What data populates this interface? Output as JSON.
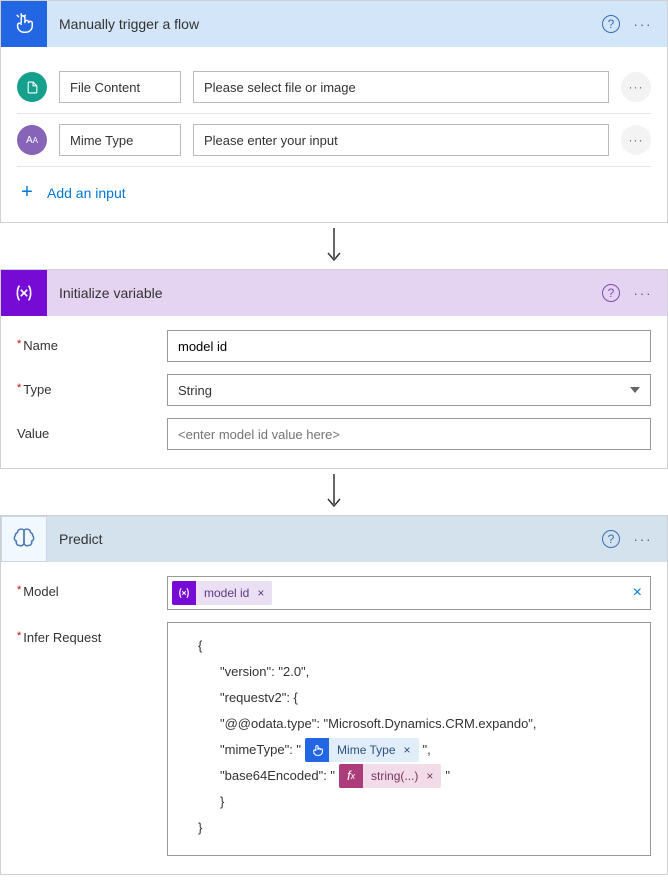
{
  "trigger": {
    "title": "Manually trigger a flow",
    "inputs": [
      {
        "label": "File Content",
        "placeholder": "Please select file or image"
      },
      {
        "label": "Mime Type",
        "placeholder": "Please enter your input"
      }
    ],
    "add_input_label": "Add an input"
  },
  "variable": {
    "title": "Initialize variable",
    "name_label": "Name",
    "name_value": "model id",
    "type_label": "Type",
    "type_value": "String",
    "value_label": "Value",
    "value_placeholder": "<enter model id value here>"
  },
  "predict": {
    "title": "Predict",
    "model_label": "Model",
    "model_token": "model id",
    "infer_label": "Infer Request",
    "json": {
      "open": "{",
      "version": "\"version\": \"2.0\",",
      "requestv2": "\"requestv2\": {",
      "odata": "\"@@odata.type\": \"Microsoft.Dynamics.CRM.expando\",",
      "mime_prefix": "\"mimeType\": \"",
      "mime_token": "Mime Type",
      "mime_suffix": "\",",
      "b64_prefix": "\"base64Encoded\": \"",
      "fx_token": "string(...)",
      "b64_suffix": "\"",
      "close_inner": "}",
      "close": "}"
    }
  }
}
